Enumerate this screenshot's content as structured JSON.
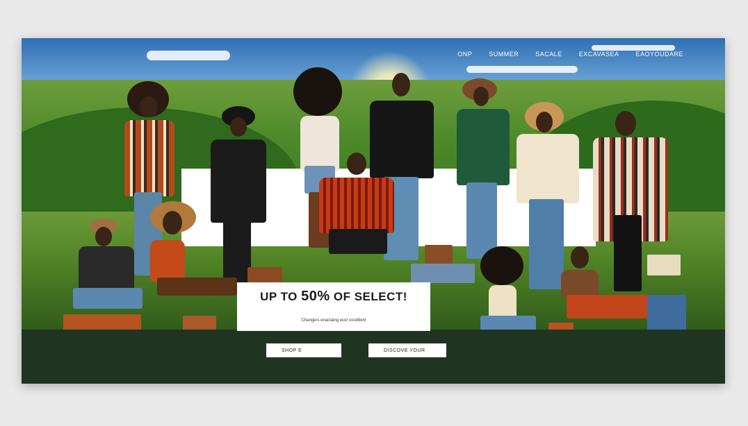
{
  "nav": {
    "items": [
      "ONP",
      "SUMMER",
      "SACALE",
      "EXCAVASEA",
      "EAOYOUDARE"
    ]
  },
  "promo": {
    "headline_pre": "UP TO ",
    "headline_big": "50%",
    "headline_post": " OF SELECT!",
    "fine_print": "",
    "subline": "Changers enactaing ecor ocodtient"
  },
  "buttons": {
    "shop_label": "SHOP E",
    "discover_label": "DISCOVE YOUR"
  },
  "footer": {
    "note": ""
  },
  "colors": {
    "accent_white": "#ffffff",
    "footer_dark": "#1f3421",
    "grass_green": "#4f8125",
    "sky_blue": "#2f6fb3"
  },
  "icons": [
    "hat-icon",
    "suitcase-icon",
    "handbag-icon"
  ]
}
